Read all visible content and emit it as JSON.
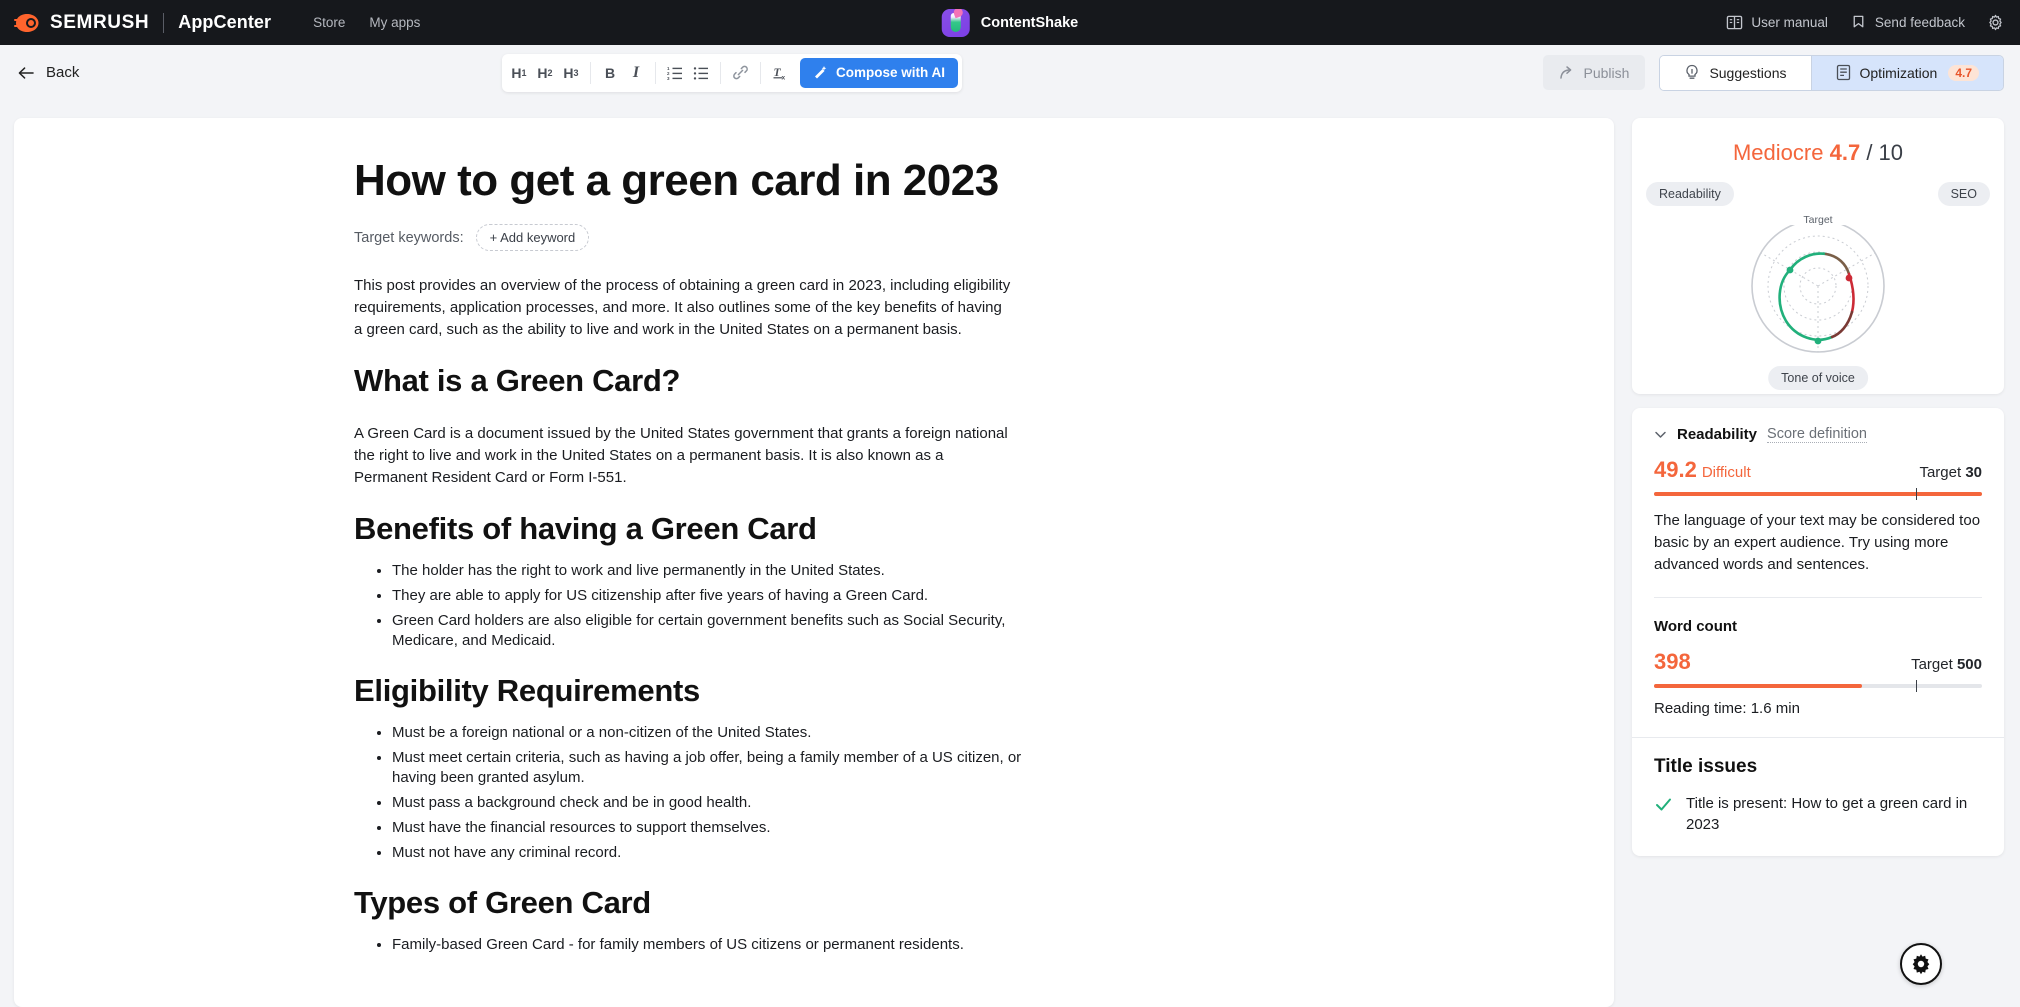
{
  "topnav": {
    "brand": "SEMRUSH",
    "product": "AppCenter",
    "links": [
      {
        "label": "Store",
        "name": "nav-link-store"
      },
      {
        "label": "My apps",
        "name": "nav-link-my-apps"
      }
    ],
    "app_title": "ContentShake",
    "right_items": [
      {
        "label": "User manual",
        "icon": "book-icon"
      },
      {
        "label": "Send feedback",
        "icon": "flag-icon"
      }
    ],
    "settings_icon": "gear-icon"
  },
  "subbar": {
    "back_label": "Back",
    "tools": [
      {
        "label": "H",
        "sub": "1",
        "name": "heading-1-button"
      },
      {
        "label": "H",
        "sub": "2",
        "name": "heading-2-button"
      },
      {
        "label": "H",
        "sub": "3",
        "name": "heading-3-button"
      },
      {
        "label": "B",
        "sub": "",
        "name": "bold-button"
      },
      {
        "label": "I",
        "sub": "",
        "name": "italic-button"
      }
    ],
    "compose_label": "Compose with AI",
    "publish_label": "Publish",
    "tab_suggestions": "Suggestions",
    "tab_optimization": "Optimization",
    "optimization_score": "4.7"
  },
  "document": {
    "title": "How to get a green card in 2023",
    "keywords_label": "Target keywords:",
    "add_keyword_label": "+ Add keyword",
    "intro": "This post provides an overview of the process of obtaining a green card in 2023, including eligibility requirements, application processes, and more. It also outlines some of the key benefits of having a green card, such as the ability to live and work in the United States on a permanent basis.",
    "h2_what": "What is a Green Card?",
    "p_what": "A Green Card is a document issued by the United States government that grants a foreign national the right to live and work in the United States on a permanent basis. It is also known as a Permanent Resident Card or Form I-551.",
    "h2_benefits": "Benefits of having a Green Card",
    "benefits": [
      "The holder has the right to work and live permanently in the United States.",
      "They are able to apply for US citizenship after five years of having a Green Card.",
      "Green Card holders are also eligible for certain government benefits such as Social Security, Medicare, and Medicaid."
    ],
    "h2_eligibility": "Eligibility Requirements",
    "eligibility": [
      "Must be a foreign national or a non-citizen of the United States.",
      "Must meet certain criteria, such as having a job offer, being a family member of a US citizen, or having been granted asylum.",
      "Must pass a background check and be in good health.",
      "Must have the financial resources to support themselves.",
      "Must not have any criminal record."
    ],
    "h2_types": "Types of Green Card",
    "types": [
      "Family-based Green Card - for family members of US citizens or permanent residents."
    ]
  },
  "optimization": {
    "score_word": "Mediocre",
    "score_value": "4.7",
    "score_out_of": "/ 10",
    "pill_readability": "Readability",
    "pill_seo": "SEO",
    "pill_tone": "Tone of voice",
    "gauge_target_label": "Target",
    "readability": {
      "section_title": "Readability",
      "score_definition": "Score definition",
      "value": "49.2",
      "label": "Difficult",
      "target_prefix": "Target",
      "target_value": "30",
      "note": "The language of your text may be considered too basic by an expert audience. Try using more advanced words and sentences."
    },
    "word_count": {
      "title": "Word count",
      "value": "398",
      "target_prefix": "Target",
      "target_value": "500",
      "reading_time": "Reading time: 1.6 min"
    },
    "title_issues": {
      "title": "Title issues",
      "items": [
        {
          "status": "ok",
          "text": "Title is present: How to get a green card in 2023"
        }
      ]
    }
  },
  "chart_data": {
    "type": "radar",
    "title": "Content score radar",
    "axes": [
      "Readability",
      "SEO",
      "Tone of voice"
    ],
    "target_ring_label": "Target",
    "series": [
      {
        "name": "Readability",
        "value": 4.9,
        "max": 10,
        "color": "#21b07b"
      },
      {
        "name": "SEO",
        "value": 4.3,
        "max": 10,
        "color": "#cc2a36"
      },
      {
        "name": "Tone of voice",
        "value": 6.6,
        "max": 10,
        "color": "#21b07b"
      }
    ],
    "rings": [
      10,
      7.5,
      5,
      2.5
    ],
    "grid": true,
    "legend": "none"
  },
  "colors": {
    "accent_orange": "#f4663c",
    "brand_orange": "#ff642d",
    "blue": "#2f80ed",
    "active_tab": "#d6e4fb",
    "green": "#21b07b",
    "red": "#cc2a36"
  }
}
